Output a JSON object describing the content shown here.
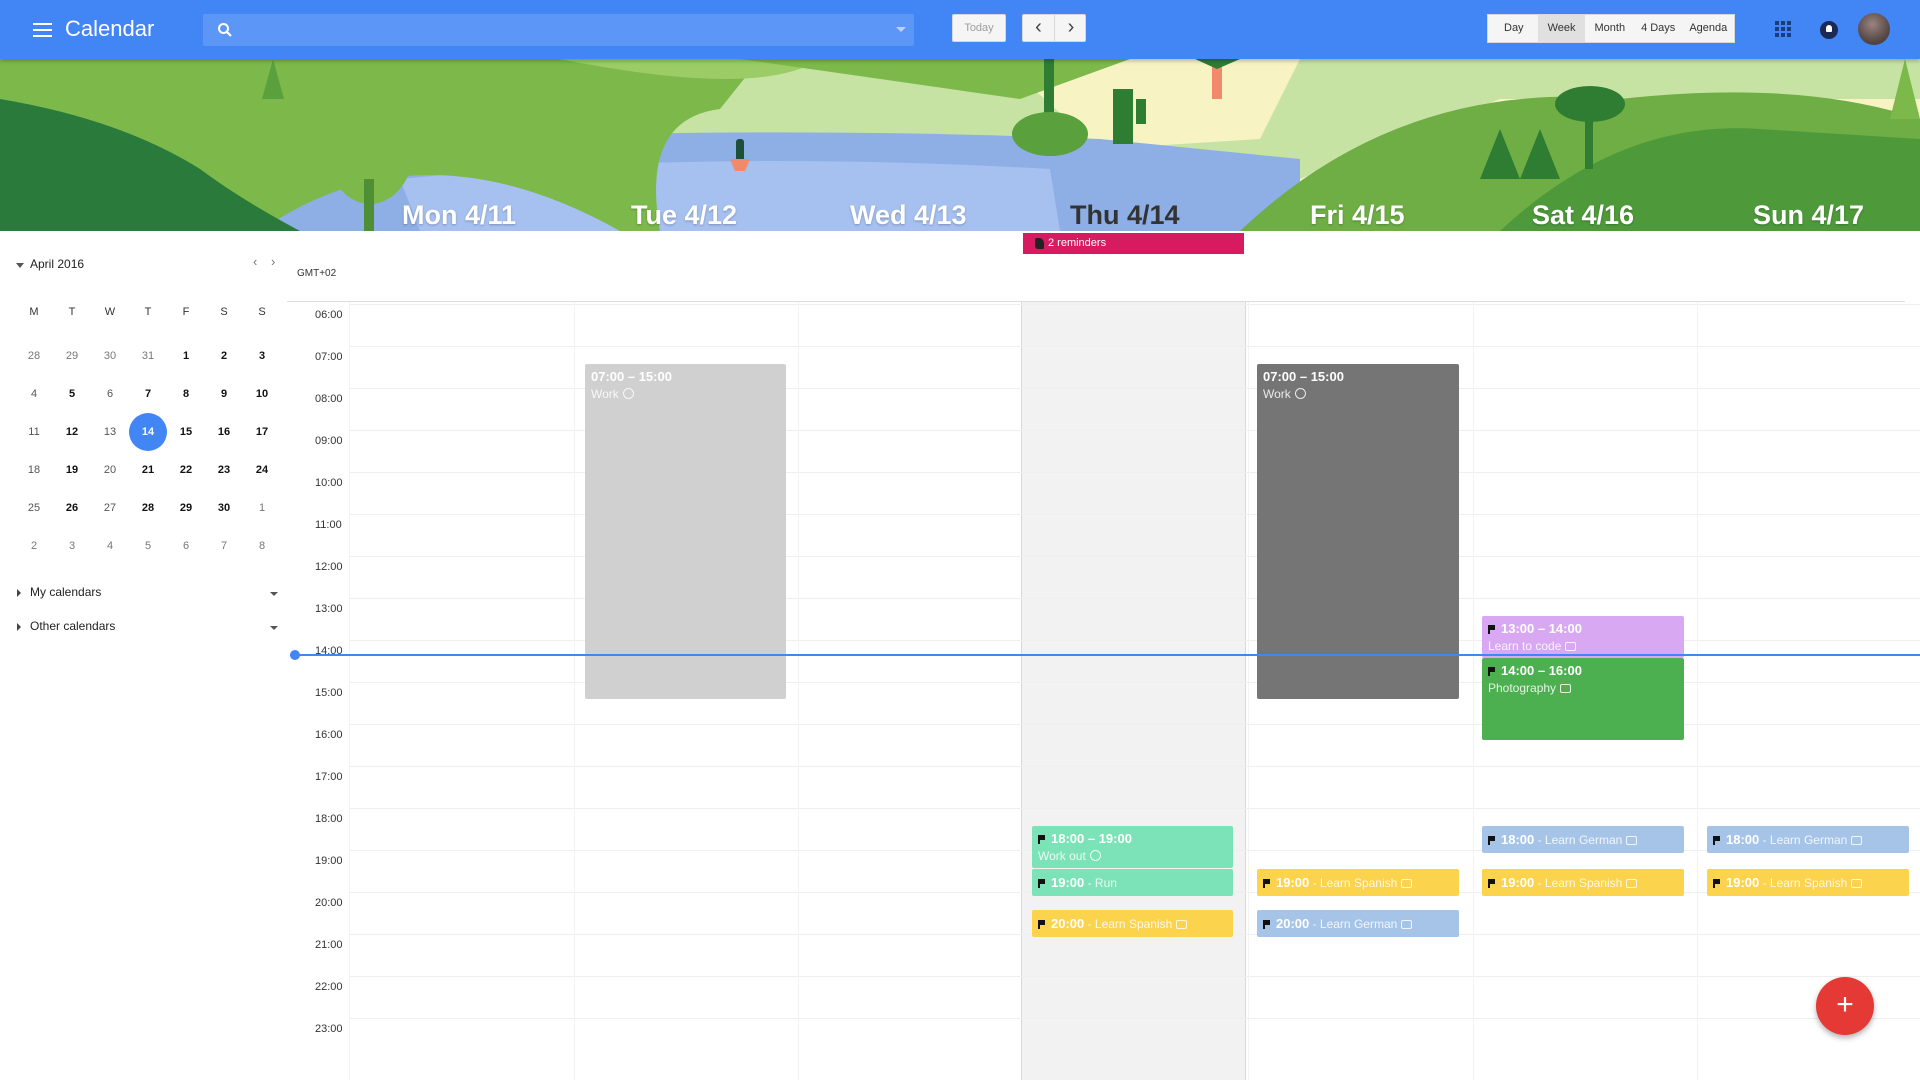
{
  "app": {
    "title": "Calendar"
  },
  "search": {
    "placeholder": "",
    "value": ""
  },
  "toolbar": {
    "today_label": "Today",
    "prev_label": "‹",
    "next_label": "›",
    "views": [
      "Day",
      "Week",
      "Month",
      "4 Days",
      "Agenda"
    ],
    "selected_view": "Week"
  },
  "icons": {
    "menu": "hamburger-icon",
    "search": "search-icon",
    "apps": "apps-grid-icon",
    "notifications": "bell-icon",
    "add": "plus-icon"
  },
  "week_days": [
    "Mon 4/11",
    "Tue 4/12",
    "Wed 4/13",
    "Thu 4/14",
    "Fri 4/15",
    "Sat 4/16",
    "Sun 4/17"
  ],
  "today_index": 3,
  "reminders_label": "2 reminders",
  "timezone": "GMT+02",
  "hours": [
    "06:00",
    "07:00",
    "08:00",
    "09:00",
    "10:00",
    "11:00",
    "12:00",
    "13:00",
    "14:00",
    "15:00",
    "16:00",
    "17:00",
    "18:00",
    "19:00",
    "20:00",
    "21:00",
    "22:00",
    "23:00"
  ],
  "mini_calendar": {
    "title": "April 2016",
    "prev": "‹",
    "next": "›",
    "weekdays": [
      "M",
      "T",
      "W",
      "T",
      "F",
      "S",
      "S"
    ],
    "weeks": [
      [
        "28",
        "29",
        "30",
        "31",
        "1",
        "2",
        "3"
      ],
      [
        "4",
        "5",
        "6",
        "7",
        "8",
        "9",
        "10"
      ],
      [
        "11",
        "12",
        "13",
        "14",
        "15",
        "16",
        "17"
      ],
      [
        "18",
        "19",
        "20",
        "21",
        "22",
        "23",
        "24"
      ],
      [
        "25",
        "26",
        "27",
        "28",
        "29",
        "30",
        "1"
      ],
      [
        "2",
        "3",
        "4",
        "5",
        "6",
        "7",
        "8"
      ]
    ],
    "selected": "14"
  },
  "calendars": {
    "my_label": "My calendars",
    "other_label": "Other calendars"
  },
  "events": {
    "tue_work": {
      "time": "07:00 – 15:00",
      "name": "Work",
      "color": "#d0d0d0"
    },
    "fri_work": {
      "time": "07:00 – 15:00",
      "name": "Work",
      "color": "#757575"
    },
    "sat_code": {
      "time": "13:00 – 14:00",
      "name": "Learn to code",
      "color": "#d9a8f2"
    },
    "sat_photo": {
      "time": "14:00 – 16:00",
      "name": "Photography",
      "color": "#4caf50"
    },
    "thu_workout": {
      "time": "18:00 – 19:00",
      "name": "Work out",
      "color": "#7be3b7"
    },
    "thu_run": {
      "time": "19:00",
      "name": " - Run",
      "color": "#7be3b7"
    },
    "thu_spanish": {
      "time": "20:00",
      "name": " - Learn Spanish",
      "color": "#fcd34d"
    },
    "fri_spanish": {
      "time": "19:00",
      "name": " - Learn Spanish",
      "color": "#fcd34d"
    },
    "fri_german": {
      "time": "20:00",
      "name": " - Learn German",
      "color": "#a5c4e8"
    },
    "sat_german": {
      "time": "18:00",
      "name": " - Learn German",
      "color": "#a5c4e8"
    },
    "sat_spanish": {
      "time": "19:00",
      "name": " - Learn Spanish",
      "color": "#fcd34d"
    },
    "sun_german": {
      "time": "18:00",
      "name": " - Learn German",
      "color": "#a5c4e8"
    },
    "sun_spanish": {
      "time": "19:00",
      "name": " - Learn Spanish",
      "color": "#fcd34d"
    }
  },
  "fab_label": "+"
}
